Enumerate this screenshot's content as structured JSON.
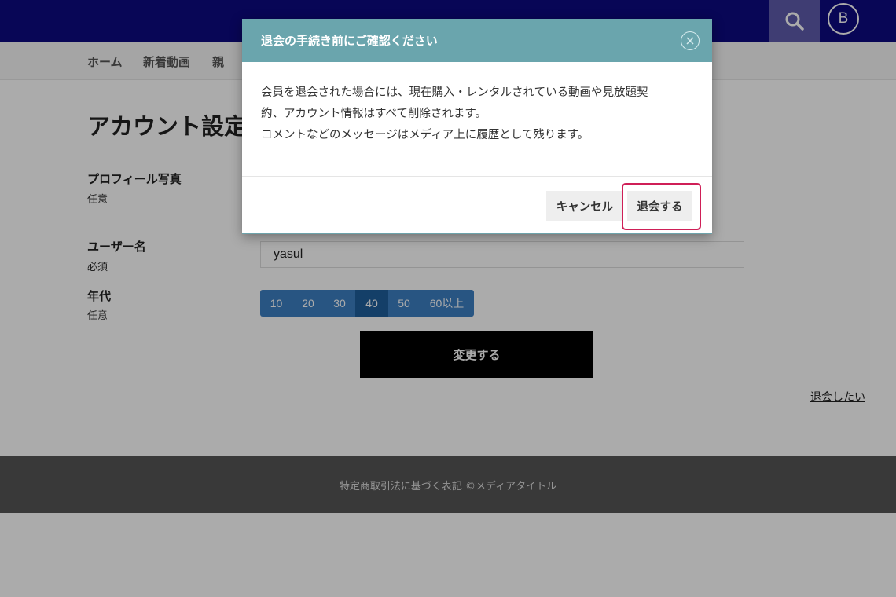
{
  "header": {
    "avatar_letter": "B",
    "accent_color": "#0c0a80"
  },
  "nav": {
    "items": [
      "ホーム",
      "新着動画",
      "親"
    ]
  },
  "page": {
    "title": "アカウント設定"
  },
  "form": {
    "profile_photo": {
      "label": "プロフィール写真",
      "sub": "任意"
    },
    "username": {
      "label": "ユーザー名",
      "sub": "必須",
      "value": "yasul"
    },
    "age": {
      "label": "年代",
      "sub": "任意",
      "options": [
        "10",
        "20",
        "30",
        "40",
        "50",
        "60以上"
      ],
      "selected": "40"
    },
    "submit_label": "変更する",
    "withdraw_link": "退会したい"
  },
  "footer": {
    "text": "特定商取引法に基づく表記 ©メディアタイトル"
  },
  "modal": {
    "title": "退会の手続き前にご確認ください",
    "body_line1": "会員を退会された場合には、現在購入・レンタルされている動画や見放題契",
    "body_line2": "約、アカウント情報はすべて削除されます。",
    "body_line3": "コメントなどのメッセージはメディア上に履歴として残ります。",
    "cancel_label": "キャンセル",
    "confirm_label": "退会する",
    "highlight_color": "#cf1f57"
  }
}
